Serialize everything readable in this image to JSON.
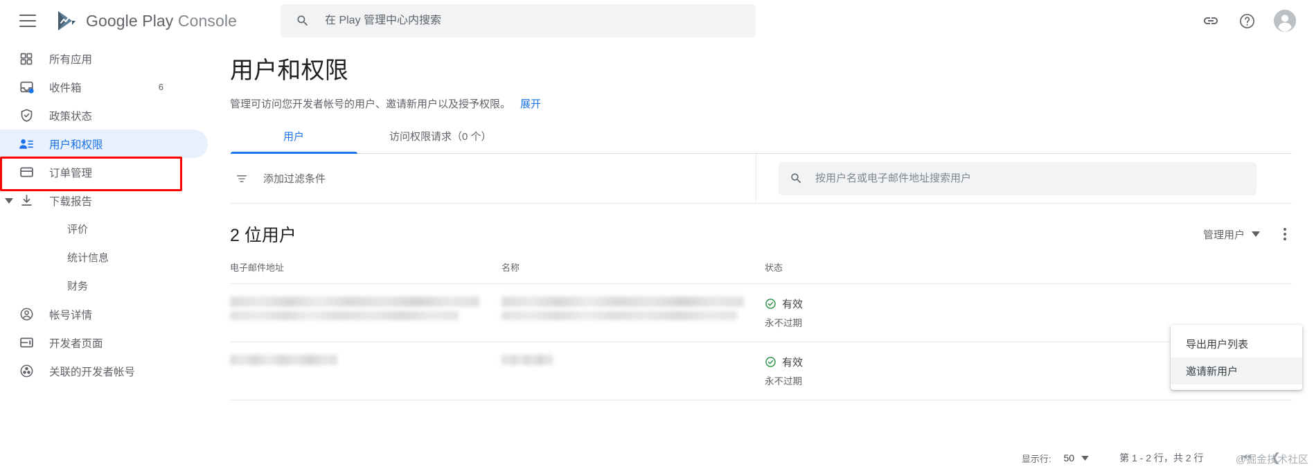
{
  "topbar": {
    "menu_icon": "hamburger-icon",
    "brand_part1": "Google Play",
    "brand_part2": "Console",
    "search_placeholder": "在 Play 管理中心内搜索",
    "search_value": "",
    "link_icon": "link-icon",
    "help_icon": "help-icon",
    "avatar_icon": "account-avatar"
  },
  "sidebar": {
    "items": [
      {
        "label": "所有应用",
        "icon": "apps-grid-icon",
        "active": false,
        "badge": "",
        "sub": false,
        "caret": false
      },
      {
        "label": "收件箱",
        "icon": "inbox-icon",
        "active": false,
        "badge": "6",
        "sub": false,
        "caret": false
      },
      {
        "label": "政策状态",
        "icon": "shield-check-icon",
        "active": false,
        "badge": "",
        "sub": false,
        "caret": false
      },
      {
        "label": "用户和权限",
        "icon": "users-permissions-icon",
        "active": true,
        "badge": "",
        "sub": false,
        "caret": false
      },
      {
        "label": "订单管理",
        "icon": "credit-card-icon",
        "active": false,
        "badge": "",
        "sub": false,
        "caret": false
      },
      {
        "label": "下载报告",
        "icon": "download-icon",
        "active": false,
        "badge": "",
        "sub": false,
        "caret": true
      },
      {
        "label": "评价",
        "icon": "",
        "active": false,
        "badge": "",
        "sub": true,
        "caret": false
      },
      {
        "label": "统计信息",
        "icon": "",
        "active": false,
        "badge": "",
        "sub": true,
        "caret": false
      },
      {
        "label": "财务",
        "icon": "",
        "active": false,
        "badge": "",
        "sub": true,
        "caret": false
      },
      {
        "label": "帐号详情",
        "icon": "account-circle-icon",
        "active": false,
        "badge": "",
        "sub": false,
        "caret": false
      },
      {
        "label": "开发者页面",
        "icon": "developer-page-icon",
        "active": false,
        "badge": "",
        "sub": false,
        "caret": false
      },
      {
        "label": "关联的开发者帐号",
        "icon": "linked-accounts-icon",
        "active": false,
        "badge": "",
        "sub": false,
        "caret": false
      }
    ]
  },
  "main": {
    "title": "用户和权限",
    "description": "管理可访问您开发者帐号的用户、邀请新用户以及授予权限。",
    "description_link": "展开",
    "tabs": [
      {
        "label": "用户",
        "active": true
      },
      {
        "label": "访问权限请求（0 个）",
        "active": false
      }
    ],
    "filter": {
      "label": "添加过滤条件",
      "icon": "filter-icon"
    },
    "user_search": {
      "placeholder": "按用户名或电子邮件地址搜索用户",
      "value": "",
      "icon": "search-icon"
    },
    "list_count": "2 位用户",
    "manage_users_label": "管理用户",
    "kebab_icon": "more-vert-icon",
    "menu": {
      "items": [
        {
          "label": "导出用户列表",
          "highlighted": false
        },
        {
          "label": "邀请新用户",
          "highlighted": true
        }
      ]
    },
    "table": {
      "columns": [
        "电子邮件地址",
        "名称",
        "状态",
        ""
      ],
      "rows": [
        {
          "email": "",
          "email_redacted": true,
          "name": "",
          "name_redacted": true,
          "status": "有效",
          "status_icon": "check-circle-icon",
          "expiry": "永不过期"
        },
        {
          "email": "",
          "email_redacted": true,
          "name": "",
          "name_redacted": true,
          "status": "有效",
          "status_icon": "check-circle-icon",
          "expiry": "永不过期"
        }
      ]
    },
    "pagination": {
      "rows_label": "显示行:",
      "rows_per_page": "50",
      "range": "第 1 - 2 行，共 2 行",
      "first_icon": "first-page-icon",
      "prev_icon": "prev-page-icon"
    },
    "watermark": "@掘金技术社区"
  },
  "colors": {
    "accent_blue": "#1a73e8",
    "active_bg": "#e8f0fe",
    "highlight_red": "#ff0000",
    "status_green": "#1e8e3e",
    "text_secondary": "#5f6368"
  }
}
